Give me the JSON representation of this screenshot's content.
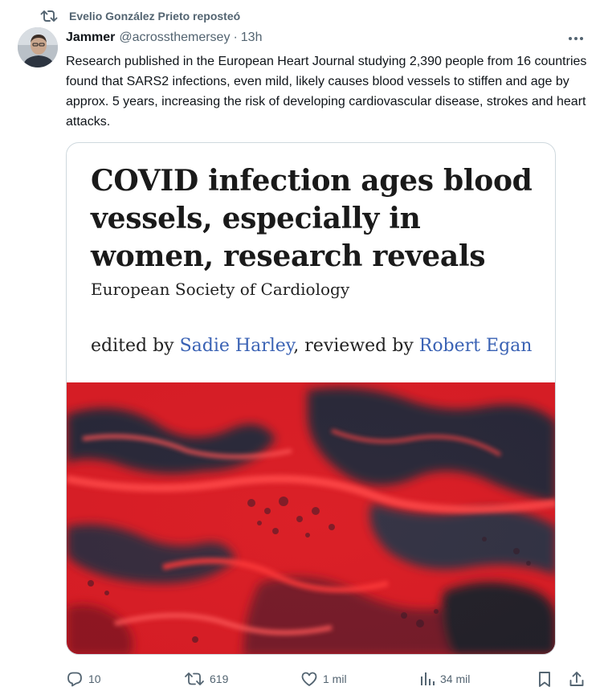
{
  "repost": {
    "icon": "repost-icon",
    "text": "Evelio González Prieto reposteó"
  },
  "author": {
    "name": "Jammer",
    "handle": "@acrossthemersey",
    "separator": "·",
    "time": "13h"
  },
  "tweet": {
    "text": "Research published in the European Heart Journal studying 2,390 people from 16 countries found that SARS2 infections, even mild, likely causes blood vessels to stiffen and age by approx. 5 years, increasing the risk of developing cardiovascular disease, strokes and heart attacks."
  },
  "card": {
    "headline": "COVID infection ages blood vessels, especially in women, research reveals",
    "source": "European Society of Cardiology",
    "credits": {
      "edited_prefix": "edited by ",
      "editor": "Sadie Harley",
      "reviewed_prefix": ", reviewed by ",
      "reviewer": "Robert Egan"
    }
  },
  "actions": {
    "reply": {
      "icon": "reply-icon",
      "count": "10"
    },
    "repost": {
      "icon": "repost-icon",
      "count": "619"
    },
    "like": {
      "icon": "heart-icon",
      "count": "1 mil"
    },
    "views": {
      "icon": "views-chart-icon",
      "count": "34 mil"
    },
    "bookmark": {
      "icon": "bookmark-icon"
    },
    "share": {
      "icon": "share-icon"
    }
  },
  "colors": {
    "text_primary": "#0f1419",
    "text_secondary": "#536471",
    "card_border": "#cfd9de",
    "link_blue": "#3a62b4",
    "image_red": "#e0202a",
    "image_dark": "#1a2a3a"
  }
}
